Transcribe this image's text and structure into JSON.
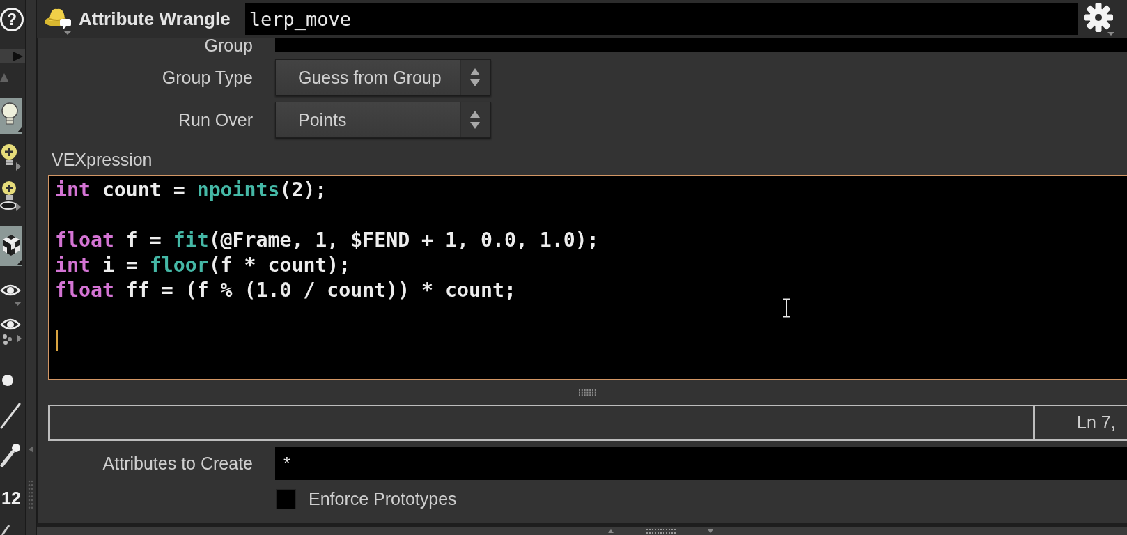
{
  "toolbar": {
    "help": "?",
    "tools": [
      {
        "kind": "bulb",
        "on": true
      },
      {
        "kind": "bulb-add",
        "on": false
      },
      {
        "kind": "bulb-disc",
        "on": false
      },
      {
        "kind": "cube",
        "on": true
      },
      {
        "kind": "eye",
        "on": false
      },
      {
        "kind": "eye-dots",
        "on": false
      },
      {
        "kind": "dot",
        "on": false
      },
      {
        "kind": "line",
        "on": false
      },
      {
        "kind": "pen",
        "on": false
      },
      {
        "kind": "number",
        "label": "12",
        "on": false
      },
      {
        "kind": "slash",
        "on": false
      }
    ]
  },
  "node": {
    "type": "Attribute Wrangle",
    "name": "lerp_move"
  },
  "parameters": [
    {
      "kind": "field",
      "label": "Group"
    },
    {
      "kind": "dropdown",
      "label": "Group Type",
      "value": "Guess from Group"
    },
    {
      "kind": "dropdown",
      "label": "Run Over",
      "value": "Points"
    },
    {
      "kind": "code",
      "label": "VEXpression",
      "lines": [
        {
          "caret": false,
          "tokens": [
            {
              "kind": "keyword",
              "text": "int"
            },
            {
              "kind": "plain",
              "text": " count = "
            },
            {
              "kind": "function",
              "text": "npoints"
            },
            {
              "kind": "plain",
              "text": "(2);"
            }
          ]
        },
        {
          "caret": false
        },
        {
          "caret": false,
          "tokens": [
            {
              "kind": "keyword",
              "text": "float"
            },
            {
              "kind": "plain",
              "text": " f = "
            },
            {
              "kind": "function",
              "text": "fit"
            },
            {
              "kind": "plain",
              "text": "(@Frame, 1, $FEND + 1, 0.0, 1.0);"
            }
          ]
        },
        {
          "caret": false,
          "tokens": [
            {
              "kind": "keyword",
              "text": "int"
            },
            {
              "kind": "plain",
              "text": " i = "
            },
            {
              "kind": "function",
              "text": "floor"
            },
            {
              "kind": "plain",
              "text": "(f * count);"
            }
          ]
        },
        {
          "caret": false,
          "tokens": [
            {
              "kind": "keyword",
              "text": "float"
            },
            {
              "kind": "plain",
              "text": " ff = (f % (1.0 / count)) * count;"
            }
          ]
        },
        {
          "caret": false
        },
        {
          "caret": true
        }
      ],
      "status": "Ln 7,"
    },
    {
      "kind": "field",
      "label": "Attributes to Create",
      "value": "*"
    },
    {
      "kind": "toggle",
      "label": "Enforce Prototypes",
      "checked": false
    }
  ]
}
